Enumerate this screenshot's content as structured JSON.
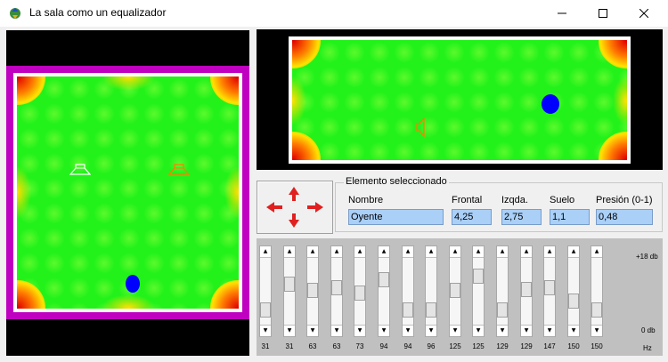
{
  "window": {
    "title": "La sala como un equalizador",
    "minimize_icon": "minimize-icon",
    "maximize_icon": "maximize-icon",
    "close_icon": "close-icon"
  },
  "colors": {
    "room_green": "#22f21a",
    "wall_magenta": "#c000c0",
    "listener": "#0000ff",
    "speaker_left": "#ffffff",
    "speaker_right": "#ff8000",
    "panel_bg": "#000000",
    "field_bg": "#aad0f8"
  },
  "direction_pad": {
    "icons": [
      "arrow-up-icon",
      "arrow-down-icon",
      "arrow-left-icon",
      "arrow-right-icon"
    ]
  },
  "selected": {
    "group_title": "Elemento seleccionado",
    "name_label": "Nombre",
    "name_value": "Oyente",
    "front_label": "Frontal",
    "front_value": "4,25",
    "left_label": "Izqda.",
    "left_value": "2,75",
    "floor_label": "Suelo",
    "floor_value": "1,1",
    "pressure_label": "Presión (0-1)",
    "pressure_value": "0,48"
  },
  "equalizer": {
    "top_label": "+18 db",
    "bottom_label": "0 db",
    "unit_label": "Hz",
    "bands": [
      {
        "hz": "31",
        "level": 0.15
      },
      {
        "hz": "31",
        "level": 0.65
      },
      {
        "hz": "63",
        "level": 0.52
      },
      {
        "hz": "63",
        "level": 0.57
      },
      {
        "hz": "73",
        "level": 0.48
      },
      {
        "hz": "94",
        "level": 0.73
      },
      {
        "hz": "94",
        "level": 0.15
      },
      {
        "hz": "96",
        "level": 0.15
      },
      {
        "hz": "125",
        "level": 0.53
      },
      {
        "hz": "125",
        "level": 0.8
      },
      {
        "hz": "129",
        "level": 0.15
      },
      {
        "hz": "129",
        "level": 0.55
      },
      {
        "hz": "147",
        "level": 0.57
      },
      {
        "hz": "150",
        "level": 0.32
      },
      {
        "hz": "150",
        "level": 0.15
      }
    ]
  }
}
